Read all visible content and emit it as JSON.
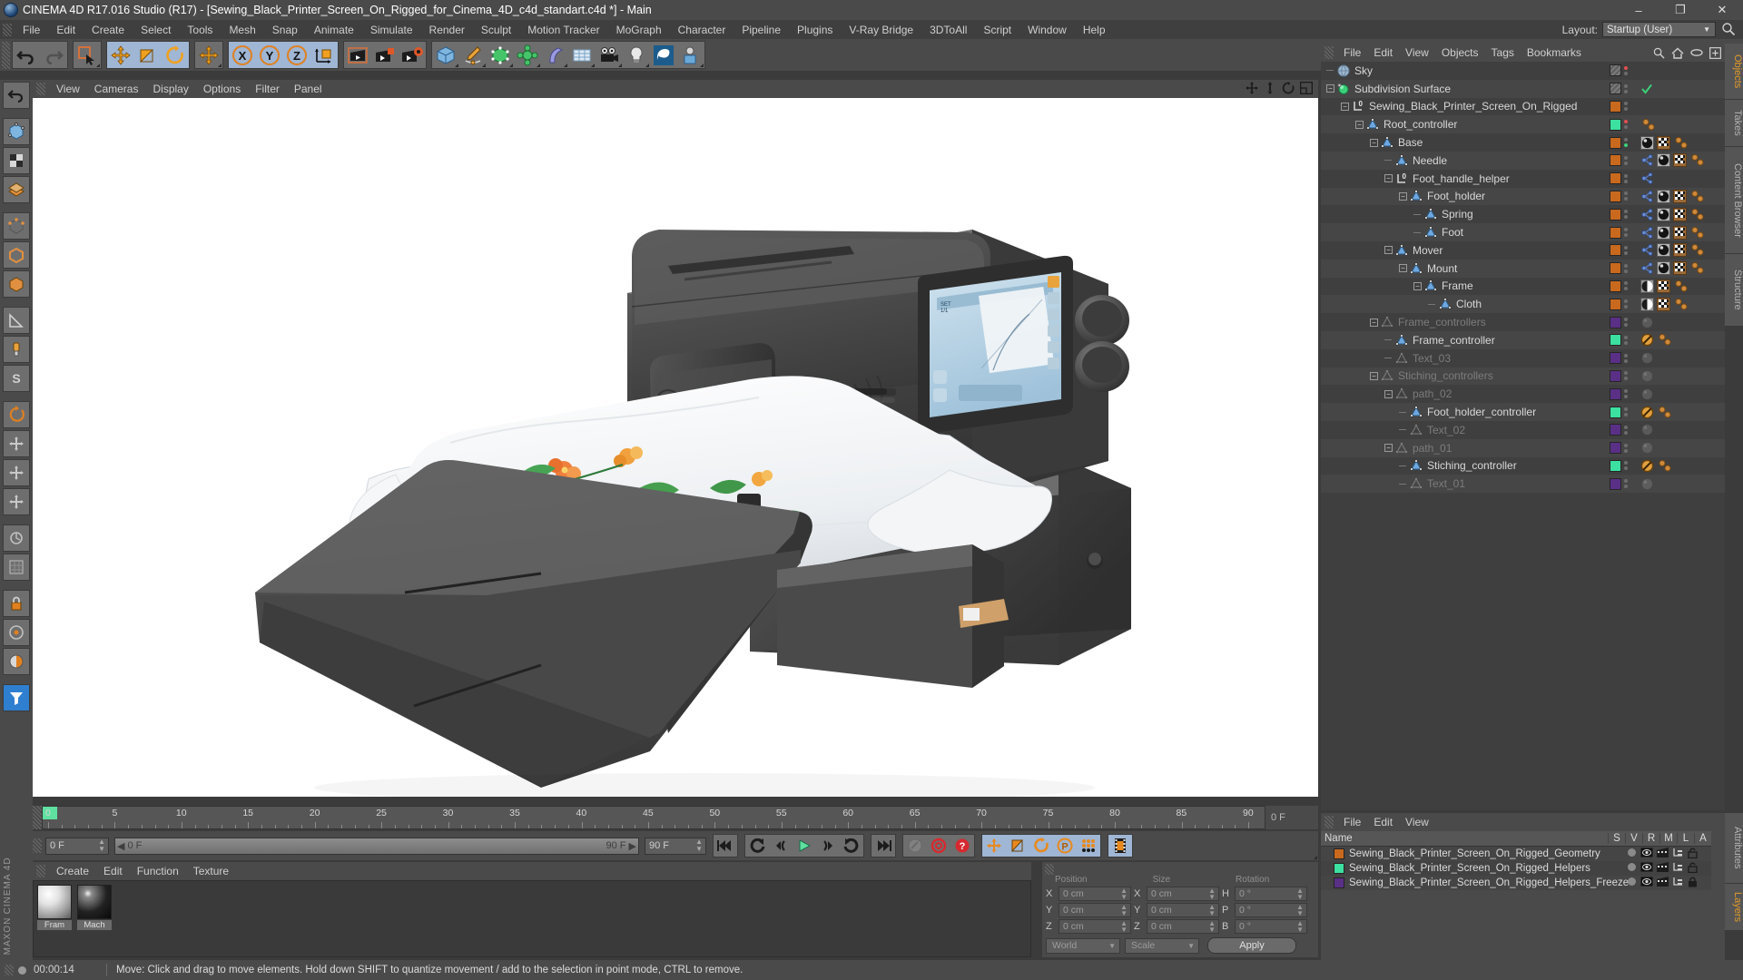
{
  "window": {
    "title": "CINEMA 4D R17.016 Studio (R17) - [Sewing_Black_Printer_Screen_On_Rigged_for_Cinema_4D_c4d_standart.c4d *] - Main",
    "minimize": "–",
    "maximize": "❐",
    "close": "✕"
  },
  "menubar": {
    "items": [
      "File",
      "Edit",
      "Create",
      "Select",
      "Tools",
      "Mesh",
      "Snap",
      "Animate",
      "Simulate",
      "Render",
      "Sculpt",
      "Motion Tracker",
      "MoGraph",
      "Character",
      "Pipeline",
      "Plugins",
      "V-Ray Bridge",
      "3DToAll",
      "Script",
      "Window",
      "Help"
    ],
    "layout_label": "Layout:",
    "layout_value": "Startup (User)"
  },
  "viewport_menu": {
    "items": [
      "View",
      "Cameras",
      "Display",
      "Options",
      "Filter",
      "Panel"
    ]
  },
  "object_manager": {
    "menu": [
      "File",
      "Edit",
      "View",
      "Objects",
      "Tags",
      "Bookmarks"
    ],
    "rows": [
      {
        "label": "Sky",
        "depth": 0,
        "icon": "sky-icon",
        "expand": "",
        "state": "normal",
        "swatch": "hatch",
        "tags": []
      },
      {
        "label": "Subdivision Surface",
        "depth": 0,
        "icon": "subdivision-icon",
        "expand": "minus",
        "state": "normal",
        "swatch": "hatch",
        "tags": [
          "check"
        ]
      },
      {
        "label": "Sewing_Black_Printer_Screen_On_Rigged",
        "depth": 1,
        "icon": "null-zero-icon",
        "expand": "minus",
        "state": "normal",
        "swatch": "#c8691e",
        "tags": []
      },
      {
        "label": "Root_controller",
        "depth": 2,
        "icon": "cone-icon",
        "expand": "minus",
        "state": "normal",
        "swatch": "#3ce0a0",
        "tags": [
          "xpresso"
        ]
      },
      {
        "label": "Base",
        "depth": 3,
        "icon": "cone-icon",
        "expand": "minus",
        "state": "normal",
        "swatch": "#c8691e",
        "tags": [
          "material",
          "uv",
          "xpresso"
        ]
      },
      {
        "label": "Needle",
        "depth": 4,
        "icon": "cone-icon",
        "expand": "",
        "state": "normal",
        "swatch": "#c8691e",
        "tags": [
          "phong",
          "material",
          "uv",
          "xpresso"
        ]
      },
      {
        "label": "Foot_handle_helper",
        "depth": 4,
        "icon": "null-zero-icon",
        "expand": "minus",
        "state": "normal",
        "swatch": "#c8691e",
        "tags": [
          "phong"
        ]
      },
      {
        "label": "Foot_holder",
        "depth": 5,
        "icon": "cone-icon",
        "expand": "minus",
        "state": "normal",
        "swatch": "#c8691e",
        "tags": [
          "phong",
          "material",
          "uv",
          "xpresso"
        ]
      },
      {
        "label": "Spring",
        "depth": 6,
        "icon": "cone-icon",
        "expand": "",
        "state": "normal",
        "swatch": "#c8691e",
        "tags": [
          "phong",
          "material",
          "uv",
          "xpresso"
        ]
      },
      {
        "label": "Foot",
        "depth": 6,
        "icon": "cone-icon",
        "expand": "",
        "state": "normal",
        "swatch": "#c8691e",
        "tags": [
          "phong",
          "material",
          "uv",
          "xpresso"
        ]
      },
      {
        "label": "Mover",
        "depth": 4,
        "icon": "cone-icon",
        "expand": "minus",
        "state": "normal",
        "swatch": "#c8691e",
        "tags": [
          "phong",
          "material",
          "uv",
          "xpresso"
        ]
      },
      {
        "label": "Mount",
        "depth": 5,
        "icon": "cone-icon",
        "expand": "minus",
        "state": "normal",
        "swatch": "#c8691e",
        "tags": [
          "phong",
          "material",
          "uv",
          "xpresso"
        ]
      },
      {
        "label": "Frame",
        "depth": 6,
        "icon": "cone-icon",
        "expand": "minus",
        "state": "normal",
        "swatch": "#c8691e",
        "tags": [
          "cloth",
          "uv",
          "xpresso"
        ]
      },
      {
        "label": "Cloth",
        "depth": 7,
        "icon": "cone-icon",
        "expand": "",
        "state": "normal",
        "swatch": "#c8691e",
        "tags": [
          "cloth",
          "uv",
          "xpresso"
        ]
      },
      {
        "label": "Frame_controllers",
        "depth": 3,
        "icon": "cone-dim-icon",
        "expand": "minus",
        "state": "dim",
        "swatch": "#5a2f86",
        "tags": [
          "greyball"
        ]
      },
      {
        "label": "Frame_controller",
        "depth": 4,
        "icon": "cone-icon",
        "expand": "",
        "state": "normal",
        "swatch": "#3ce0a0",
        "tags": [
          "protect",
          "xpresso"
        ]
      },
      {
        "label": "Text_03",
        "depth": 4,
        "icon": "cone-dim-icon",
        "expand": "",
        "state": "dim",
        "swatch": "#5a2f86",
        "tags": [
          "greyball"
        ]
      },
      {
        "label": "Stiching_controllers",
        "depth": 3,
        "icon": "cone-dim-icon",
        "expand": "minus",
        "state": "dim",
        "swatch": "#5a2f86",
        "tags": [
          "greyball"
        ]
      },
      {
        "label": "path_02",
        "depth": 4,
        "icon": "cone-dim-icon",
        "expand": "minus",
        "state": "dim",
        "swatch": "#5a2f86",
        "tags": [
          "greyball"
        ]
      },
      {
        "label": "Foot_holder_controller",
        "depth": 5,
        "icon": "cone-icon",
        "expand": "",
        "state": "normal",
        "swatch": "#3ce0a0",
        "tags": [
          "protect",
          "xpresso"
        ]
      },
      {
        "label": "Text_02",
        "depth": 5,
        "icon": "cone-dim-icon",
        "expand": "",
        "state": "dim",
        "swatch": "#5a2f86",
        "tags": [
          "greyball"
        ]
      },
      {
        "label": "path_01",
        "depth": 4,
        "icon": "cone-dim-icon",
        "expand": "minus",
        "state": "dim",
        "swatch": "#5a2f86",
        "tags": [
          "greyball"
        ]
      },
      {
        "label": "Stiching_controller",
        "depth": 5,
        "icon": "cone-icon",
        "expand": "",
        "state": "normal",
        "swatch": "#3ce0a0",
        "tags": [
          "protect",
          "xpresso"
        ]
      },
      {
        "label": "Text_01",
        "depth": 5,
        "icon": "cone-dim-icon",
        "expand": "",
        "state": "dim",
        "swatch": "#5a2f86",
        "tags": [
          "greyball"
        ]
      }
    ]
  },
  "layer_manager": {
    "menu": [
      "File",
      "Edit",
      "View"
    ],
    "columns": [
      "Name",
      "S",
      "V",
      "R",
      "M",
      "L",
      "A"
    ],
    "rows": [
      {
        "name": "Sewing_Black_Printer_Screen_On_Rigged_Geometry",
        "color": "#c8691e",
        "locked": false
      },
      {
        "name": "Sewing_Black_Printer_Screen_On_Rigged_Helpers",
        "color": "#3ce0a0",
        "locked": false
      },
      {
        "name": "Sewing_Black_Printer_Screen_On_Rigged_Helpers_Freeze",
        "color": "#5a2f86",
        "locked": true
      }
    ]
  },
  "right_tabs": {
    "top": [
      "Objects",
      "Takes",
      "Content Browser",
      "Structure"
    ],
    "bottom": [
      "Attributes",
      "Layers"
    ],
    "active": "Objects"
  },
  "timeline": {
    "ticks": [
      0,
      5,
      10,
      15,
      20,
      25,
      30,
      35,
      40,
      45,
      50,
      55,
      60,
      65,
      70,
      75,
      80,
      85,
      90
    ],
    "current_frame_label": "0 F",
    "end_label": "0 F"
  },
  "playback": {
    "start_field": "0 F",
    "slider_left": "0 F",
    "slider_right": "90 F",
    "end_field": "90 F",
    "buttons": [
      "goto-start",
      "prev-key",
      "prev-frame",
      "play",
      "next-frame",
      "next-key",
      "goto-end",
      "record-active-objects",
      "autokey",
      "keyframe-selection"
    ],
    "toggles": [
      "position",
      "scale",
      "rotation",
      "param",
      "pla",
      "animation-mode"
    ]
  },
  "materials": {
    "menu": [
      "Create",
      "Edit",
      "Function",
      "Texture"
    ],
    "items": [
      {
        "label": "Fram",
        "type": "light-sphere"
      },
      {
        "label": "Mach",
        "type": "dark-sphere"
      }
    ]
  },
  "coordinates": {
    "headers": [
      "Position",
      "Size",
      "Rotation"
    ],
    "position": {
      "X": "0 cm",
      "Y": "0 cm",
      "Z": "0 cm"
    },
    "size": {
      "X": "0 cm",
      "Y": "0 cm",
      "Z": "0 cm"
    },
    "rotation": {
      "H": "0 °",
      "P": "0 °",
      "B": "0 °"
    },
    "space": "World",
    "mode": "Scale",
    "apply": "Apply"
  },
  "statusbar": {
    "time": "00:00:14",
    "message": "Move: Click and drag to move elements. Hold down SHIFT to quantize movement / add to the selection in point mode, CTRL to remove."
  },
  "branding": {
    "maxon": "MAXON",
    "product": "CINEMA 4D"
  }
}
